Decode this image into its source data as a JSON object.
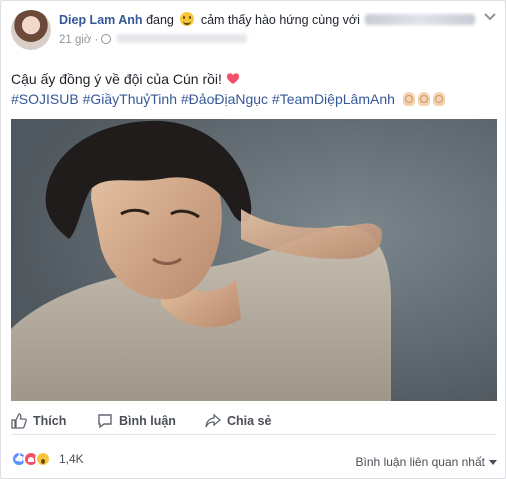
{
  "post": {
    "author": "Diep Lam Anh",
    "feeling_prefix": "đang",
    "feeling_text": "cảm thấy hào hứng cùng với",
    "timestamp": "21 giờ",
    "text": "Cậu ấy đồng ý về đội của Cún rồi!",
    "hashtags": "#SOJISUB #GiầyThuỷTinh #ĐảoĐịaNgục #TeamDiệpLâmAnh"
  },
  "actions": {
    "like": "Thích",
    "comment": "Bình luận",
    "share": "Chia sẻ"
  },
  "reactions": {
    "count": "1,4K",
    "types": [
      "like-icon",
      "love-icon",
      "wow-icon"
    ]
  },
  "comments_sort": {
    "label": "Bình luận liên quan nhất"
  },
  "colors": {
    "link_blue": "#365899",
    "muted_text": "#90949c",
    "like_blue": "#5890ff",
    "love_red": "#f25268",
    "wow_yellow": "#f7c63b"
  }
}
